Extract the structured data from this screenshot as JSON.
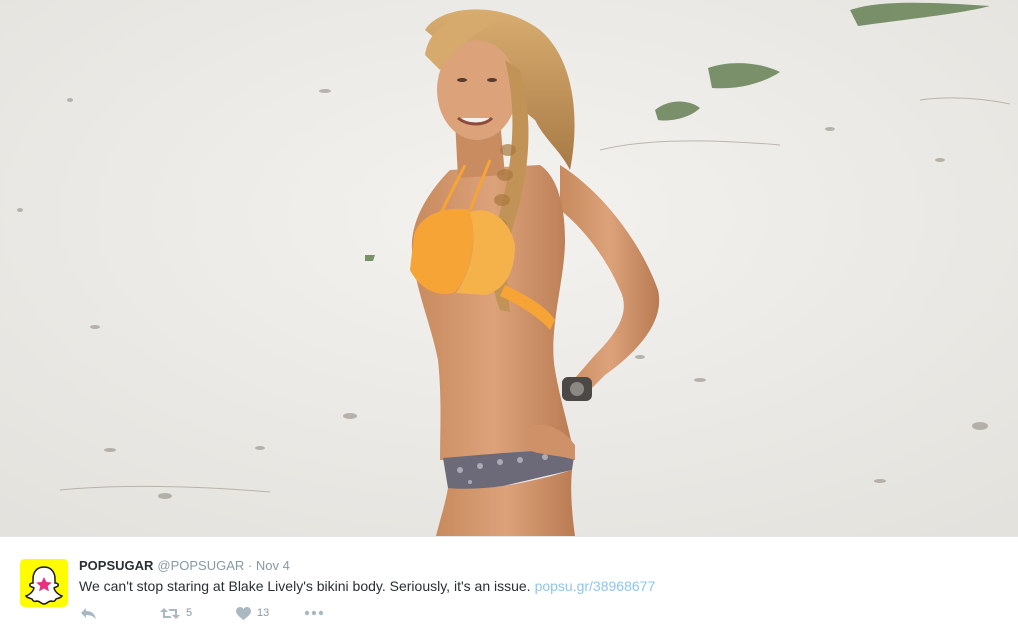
{
  "photo": {
    "icon": "beach-photo",
    "colors": {
      "sand": "#ecebe8",
      "bikini_top": "#f7a437",
      "skin": "#d89a70",
      "hair": "#c8995a"
    }
  },
  "tweet": {
    "author_name": "POPSUGAR",
    "handle": "@POPSUGAR",
    "separator": "·",
    "date": "Nov 4",
    "text": "We can't stop staring at Blake Lively's bikini body. Seriously, it's an issue.",
    "link": "popsu.gr/38968677",
    "avatar": {
      "icon": "snapchat-ghost-star",
      "bg": "#fffc00",
      "star_color": "#e8317c"
    },
    "actions": {
      "reply": {
        "icon": "reply-icon"
      },
      "retweet": {
        "icon": "retweet-icon",
        "count": "5"
      },
      "like": {
        "icon": "heart-icon",
        "count": "13"
      },
      "more": {
        "icon": "more-dots-icon"
      }
    }
  },
  "colors": {
    "text": "#292f33",
    "muted": "#8899a6",
    "link": "#8ec5ee"
  }
}
